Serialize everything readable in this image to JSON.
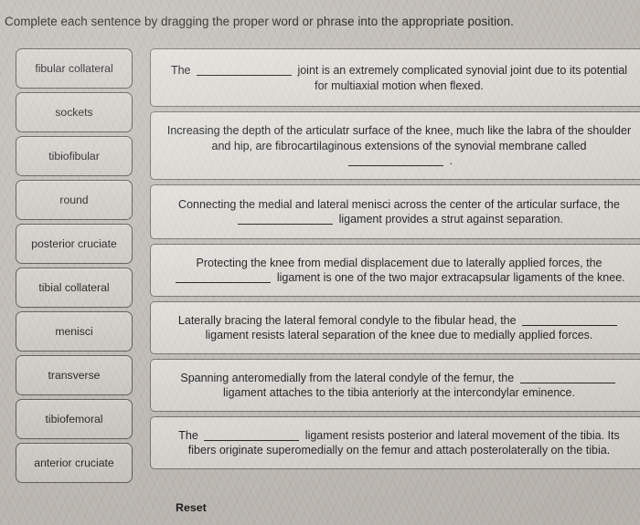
{
  "instruction": "Complete each sentence by dragging the proper word or phrase into the appropriate position.",
  "word_bank": {
    "items": [
      {
        "label": "fibular collateral"
      },
      {
        "label": "sockets"
      },
      {
        "label": "tibiofibular"
      },
      {
        "label": "round"
      },
      {
        "label": "posterior cruciate"
      },
      {
        "label": "tibial collateral"
      },
      {
        "label": "menisci"
      },
      {
        "label": "transverse"
      },
      {
        "label": "tibiofemoral"
      },
      {
        "label": "anterior cruciate"
      }
    ]
  },
  "sentences": [
    {
      "pre": "The",
      "post": "joint is an extremely complicated synovial joint due to its potential for multiaxial motion when flexed.",
      "blank_position": "middle"
    },
    {
      "pre": "Increasing the depth of the articulatr surface of the knee, much like the labra of the shoulder and hip, are fibrocartilaginous extensions of the synovial membrane called",
      "post": ".",
      "blank_position": "end"
    },
    {
      "pre": "Connecting the medial and lateral menisci across the center of the articular surface, the",
      "post": "ligament provides a strut against separation.",
      "blank_position": "middle"
    },
    {
      "pre": "Protecting the knee from medial displacement due to laterally applied forces, the",
      "post": "ligament is one of the two major extracapsular ligaments of the knee.",
      "blank_position": "middle"
    },
    {
      "pre": "Laterally bracing the lateral femoral condyle to the fibular head, the",
      "post": "ligament resists lateral separation of the knee due to medially applied forces.",
      "blank_position": "middle"
    },
    {
      "pre": "Spanning anteromedially from the lateral condyle of the femur, the",
      "post": "ligament attaches to the tibia anteriorly at the intercondylar eminence.",
      "blank_position": "middle"
    },
    {
      "pre": "The",
      "post": "ligament resists posterior and lateral movement of the tibia. Its fibers originate superomedially on the femur and attach posterolaterally on the tibia.",
      "blank_position": "middle"
    }
  ],
  "reset": {
    "label": "Reset"
  },
  "colors": {
    "page_background": "#b9b5ae",
    "chip_fill": "#cfccc6",
    "chip_border": "#55524e",
    "sentence_fill": "#dddad4",
    "sentence_border": "#6b6862",
    "text": "#16181a"
  }
}
